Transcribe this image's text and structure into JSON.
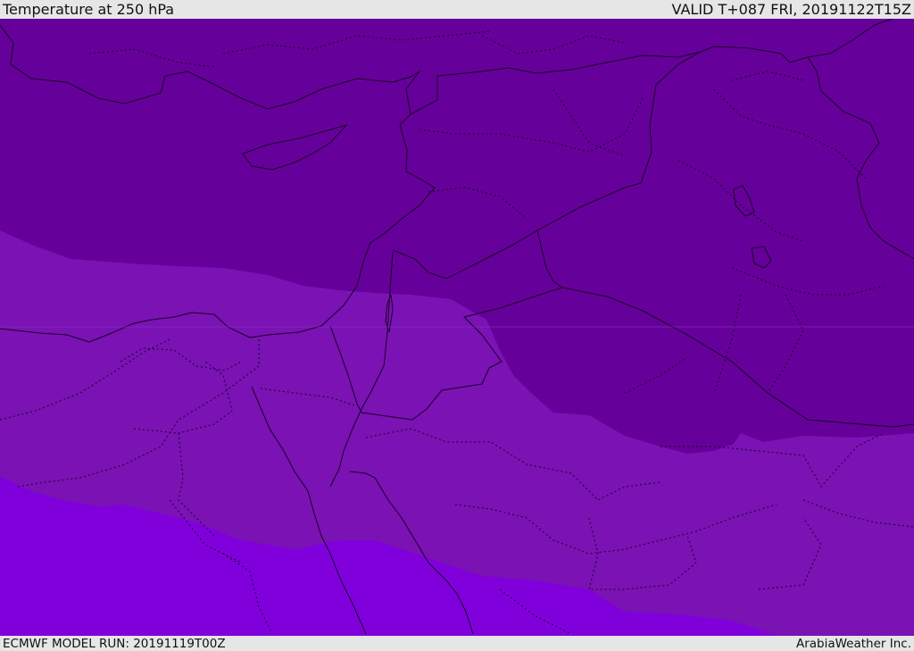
{
  "header": {
    "title": "Temperature at 250 hPa",
    "valid_time": "VALID T+087 FRI, 20191122T15Z"
  },
  "footer": {
    "model_run": "ECMWF MODEL RUN: 20191119T00Z",
    "credit": "ArabiaWeather Inc."
  },
  "map": {
    "colors": {
      "band_cold": "#66009a",
      "band_mid": "#7a12b4",
      "band_warm": "#8000dc",
      "line": "#1a0026"
    }
  }
}
